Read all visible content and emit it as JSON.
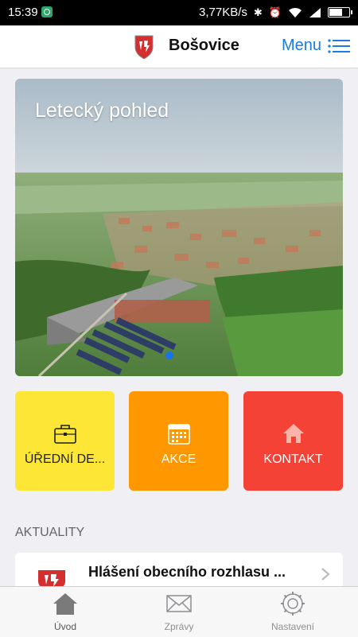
{
  "status_bar": {
    "time": "15:39",
    "net_speed": "3,77KB/s",
    "bluetooth": "✱",
    "alarm": "⏰",
    "wifi": "wifi-icon",
    "signal": "▮"
  },
  "header": {
    "title": "Bošovice",
    "menu_label": "Menu"
  },
  "hero": {
    "caption": "Letecký pohled"
  },
  "tiles": [
    {
      "label": "ÚŘEDNÍ DE...",
      "icon": "briefcase-icon",
      "color": "#fde636"
    },
    {
      "label": "AKCE",
      "icon": "calendar-icon",
      "color": "#ff9800"
    },
    {
      "label": "KONTAKT",
      "icon": "home-icon",
      "color": "#f44336"
    }
  ],
  "section_title": "AKTUALITY",
  "news": [
    {
      "title": "Hlášení obecního rozhlasu ..."
    }
  ],
  "tabbar": {
    "items": [
      {
        "label": "Úvod",
        "active": true
      },
      {
        "label": "Zprávy"
      },
      {
        "label": "Nastavení"
      }
    ]
  },
  "colors": {
    "accent": "#1a7ae6",
    "tile_yellow": "#fde636",
    "tile_orange": "#ff9800",
    "tile_red": "#f44336"
  }
}
